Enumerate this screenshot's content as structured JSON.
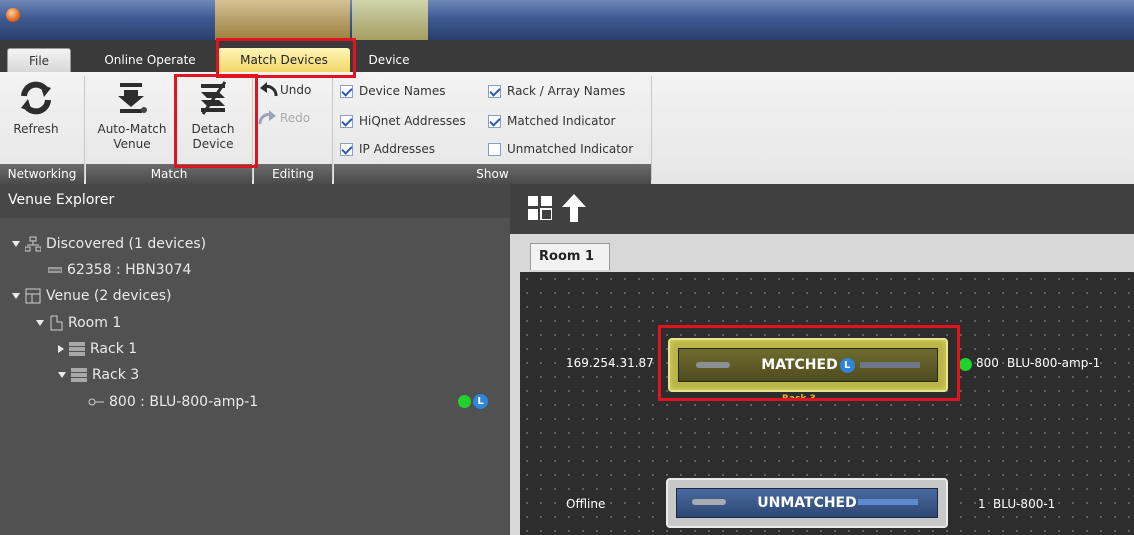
{
  "colors": {
    "highlight_red": "#e0141e",
    "status_green": "#22d02e",
    "badge_blue": "#2f86d8",
    "match_tab": "#f3d76a"
  },
  "tabs": {
    "file": "File",
    "online": "Online Operate",
    "match": "Match Devices",
    "device": "Device"
  },
  "ribbon": {
    "refresh": "Refresh",
    "auto_match_1": "Auto-Match",
    "auto_match_2": "Venue",
    "detach_1": "Detach",
    "detach_2": "Device",
    "undo": "Undo",
    "redo": "Redo",
    "checks": [
      {
        "label": "Device Names",
        "checked": true
      },
      {
        "label": "HiQnet Addresses",
        "checked": true
      },
      {
        "label": "IP Addresses",
        "checked": true
      },
      {
        "label": "Rack / Array Names",
        "checked": true
      },
      {
        "label": "Matched Indicator",
        "checked": true
      },
      {
        "label": "Unmatched Indicator",
        "checked": false
      }
    ],
    "groups": {
      "networking": "Networking",
      "match": "Match",
      "editing": "Editing",
      "show": "Show"
    }
  },
  "explorer": {
    "title": "Venue Explorer",
    "discovered": "Discovered (1 devices)",
    "discovered_device": "62358 : HBN3074",
    "venue": "Venue (2 devices)",
    "room": "Room 1",
    "rack1": "Rack 1",
    "rack3": "Rack 3",
    "device": "800 : BLU-800-amp-1",
    "badge": "L"
  },
  "canvas": {
    "tab": "Room 1",
    "matched": {
      "ip": "169.254.31.87",
      "status": "MATCHED",
      "badge": "L",
      "rack": "Rack 3",
      "address": "800",
      "name": "BLU-800-amp-1"
    },
    "unmatched": {
      "ip": "Offline",
      "status": "UNMATCHED",
      "address": "1",
      "name": "BLU-800-1"
    }
  }
}
